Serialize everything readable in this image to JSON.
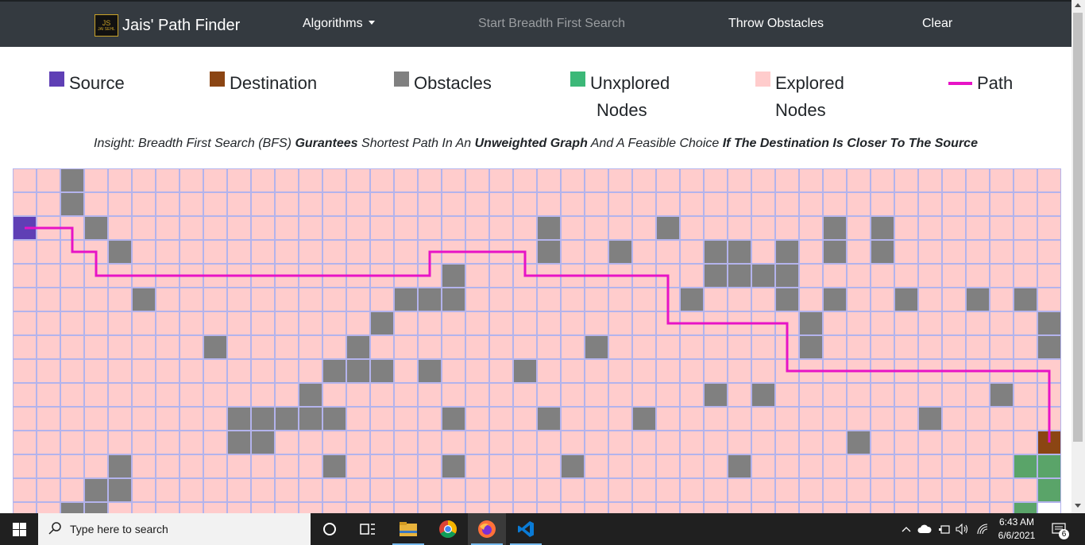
{
  "navbar": {
    "brand_title": "Jais' Path Finder",
    "brand_logo_text_top": "JS",
    "brand_logo_text_bottom": "JAI SEHL",
    "algorithms_label": "Algorithms",
    "start_label": "Start Breadth First Search",
    "throw_label": "Throw Obstacles",
    "clear_label": "Clear"
  },
  "legend": {
    "source": {
      "label": "Source",
      "color": "#5f3fb5"
    },
    "destination": {
      "label": "Destination",
      "color": "#8b4513"
    },
    "obstacles": {
      "label": "Obstacles",
      "color": "#808080"
    },
    "unexplored": {
      "label_1": "Unxplored",
      "label_2": "Nodes",
      "color": "#3cb878"
    },
    "explored": {
      "label_1": "Explored",
      "label_2": "Nodes",
      "color": "#ffcccc"
    },
    "path": {
      "label": "Path",
      "color": "#e713c6"
    }
  },
  "insight": {
    "t1": "Insight: Breadth First Search (BFS) ",
    "b1": "Gurantees",
    "t2": " Shortest Path In An ",
    "b2": "Unweighted Graph",
    "t3": " And A Feasible Choice ",
    "b3": "If The Destination Is Closer To The Source"
  },
  "grid": {
    "cols": 44,
    "visible_rows": 15,
    "cell_colors": {
      "explored": "#ffcccc",
      "obstacle": "#808080",
      "unexplored": "#5aa469",
      "source": "#5f3fb5",
      "destination": "#8b4513",
      "blank": "#ffffff",
      "grid_line": "#b3b3ec"
    },
    "source": [
      2,
      0
    ],
    "destination": [
      11,
      43
    ],
    "obstacles": [
      [
        0,
        2
      ],
      [
        1,
        2
      ],
      [
        2,
        3
      ],
      [
        2,
        22
      ],
      [
        2,
        27
      ],
      [
        2,
        34
      ],
      [
        2,
        36
      ],
      [
        3,
        4
      ],
      [
        3,
        22
      ],
      [
        3,
        25
      ],
      [
        3,
        29
      ],
      [
        3,
        30
      ],
      [
        3,
        32
      ],
      [
        3,
        34
      ],
      [
        3,
        36
      ],
      [
        4,
        18
      ],
      [
        4,
        29
      ],
      [
        4,
        30
      ],
      [
        4,
        31
      ],
      [
        4,
        32
      ],
      [
        5,
        5
      ],
      [
        5,
        16
      ],
      [
        5,
        17
      ],
      [
        5,
        18
      ],
      [
        5,
        28
      ],
      [
        5,
        32
      ],
      [
        5,
        34
      ],
      [
        5,
        37
      ],
      [
        5,
        40
      ],
      [
        5,
        42
      ],
      [
        6,
        15
      ],
      [
        6,
        33
      ],
      [
        6,
        43
      ],
      [
        7,
        8
      ],
      [
        7,
        14
      ],
      [
        7,
        24
      ],
      [
        7,
        33
      ],
      [
        7,
        43
      ],
      [
        8,
        13
      ],
      [
        8,
        14
      ],
      [
        8,
        15
      ],
      [
        8,
        17
      ],
      [
        8,
        21
      ],
      [
        9,
        12
      ],
      [
        9,
        29
      ],
      [
        9,
        31
      ],
      [
        9,
        41
      ],
      [
        10,
        9
      ],
      [
        10,
        10
      ],
      [
        10,
        11
      ],
      [
        10,
        12
      ],
      [
        10,
        13
      ],
      [
        10,
        18
      ],
      [
        10,
        22
      ],
      [
        10,
        26
      ],
      [
        10,
        38
      ],
      [
        11,
        9
      ],
      [
        11,
        10
      ],
      [
        11,
        35
      ],
      [
        12,
        4
      ],
      [
        12,
        13
      ],
      [
        12,
        18
      ],
      [
        12,
        23
      ],
      [
        12,
        30
      ],
      [
        13,
        3
      ],
      [
        13,
        4
      ],
      [
        14,
        2
      ],
      [
        14,
        3
      ]
    ],
    "unexplored": [
      [
        12,
        42
      ],
      [
        12,
        43
      ],
      [
        13,
        43
      ],
      [
        14,
        42
      ]
    ],
    "blank": [
      [
        14,
        43
      ]
    ],
    "path": [
      [
        2,
        0
      ],
      [
        2,
        1
      ],
      [
        2,
        2
      ],
      [
        3,
        2
      ],
      [
        3,
        3
      ],
      [
        4,
        3
      ],
      [
        4,
        4
      ],
      [
        4,
        5
      ],
      [
        4,
        6
      ],
      [
        4,
        7
      ],
      [
        4,
        8
      ],
      [
        4,
        9
      ],
      [
        4,
        10
      ],
      [
        4,
        11
      ],
      [
        4,
        12
      ],
      [
        4,
        13
      ],
      [
        4,
        14
      ],
      [
        4,
        15
      ],
      [
        4,
        16
      ],
      [
        4,
        17
      ],
      [
        3,
        17
      ],
      [
        3,
        18
      ],
      [
        3,
        19
      ],
      [
        3,
        20
      ],
      [
        3,
        21
      ],
      [
        4,
        21
      ],
      [
        4,
        22
      ],
      [
        4,
        23
      ],
      [
        4,
        24
      ],
      [
        4,
        25
      ],
      [
        4,
        26
      ],
      [
        4,
        27
      ],
      [
        5,
        27
      ],
      [
        6,
        27
      ],
      [
        6,
        28
      ],
      [
        6,
        29
      ],
      [
        6,
        30
      ],
      [
        6,
        31
      ],
      [
        6,
        32
      ],
      [
        7,
        32
      ],
      [
        8,
        32
      ],
      [
        8,
        33
      ],
      [
        8,
        34
      ],
      [
        8,
        35
      ],
      [
        8,
        36
      ],
      [
        8,
        37
      ],
      [
        8,
        38
      ],
      [
        8,
        39
      ],
      [
        8,
        40
      ],
      [
        8,
        41
      ],
      [
        8,
        42
      ],
      [
        8,
        43
      ],
      [
        9,
        43
      ],
      [
        10,
        43
      ],
      [
        11,
        43
      ]
    ]
  },
  "taskbar": {
    "search_placeholder": "Type here to search",
    "time": "6:43 AM",
    "date": "6/6/2021",
    "notifications": "6"
  }
}
